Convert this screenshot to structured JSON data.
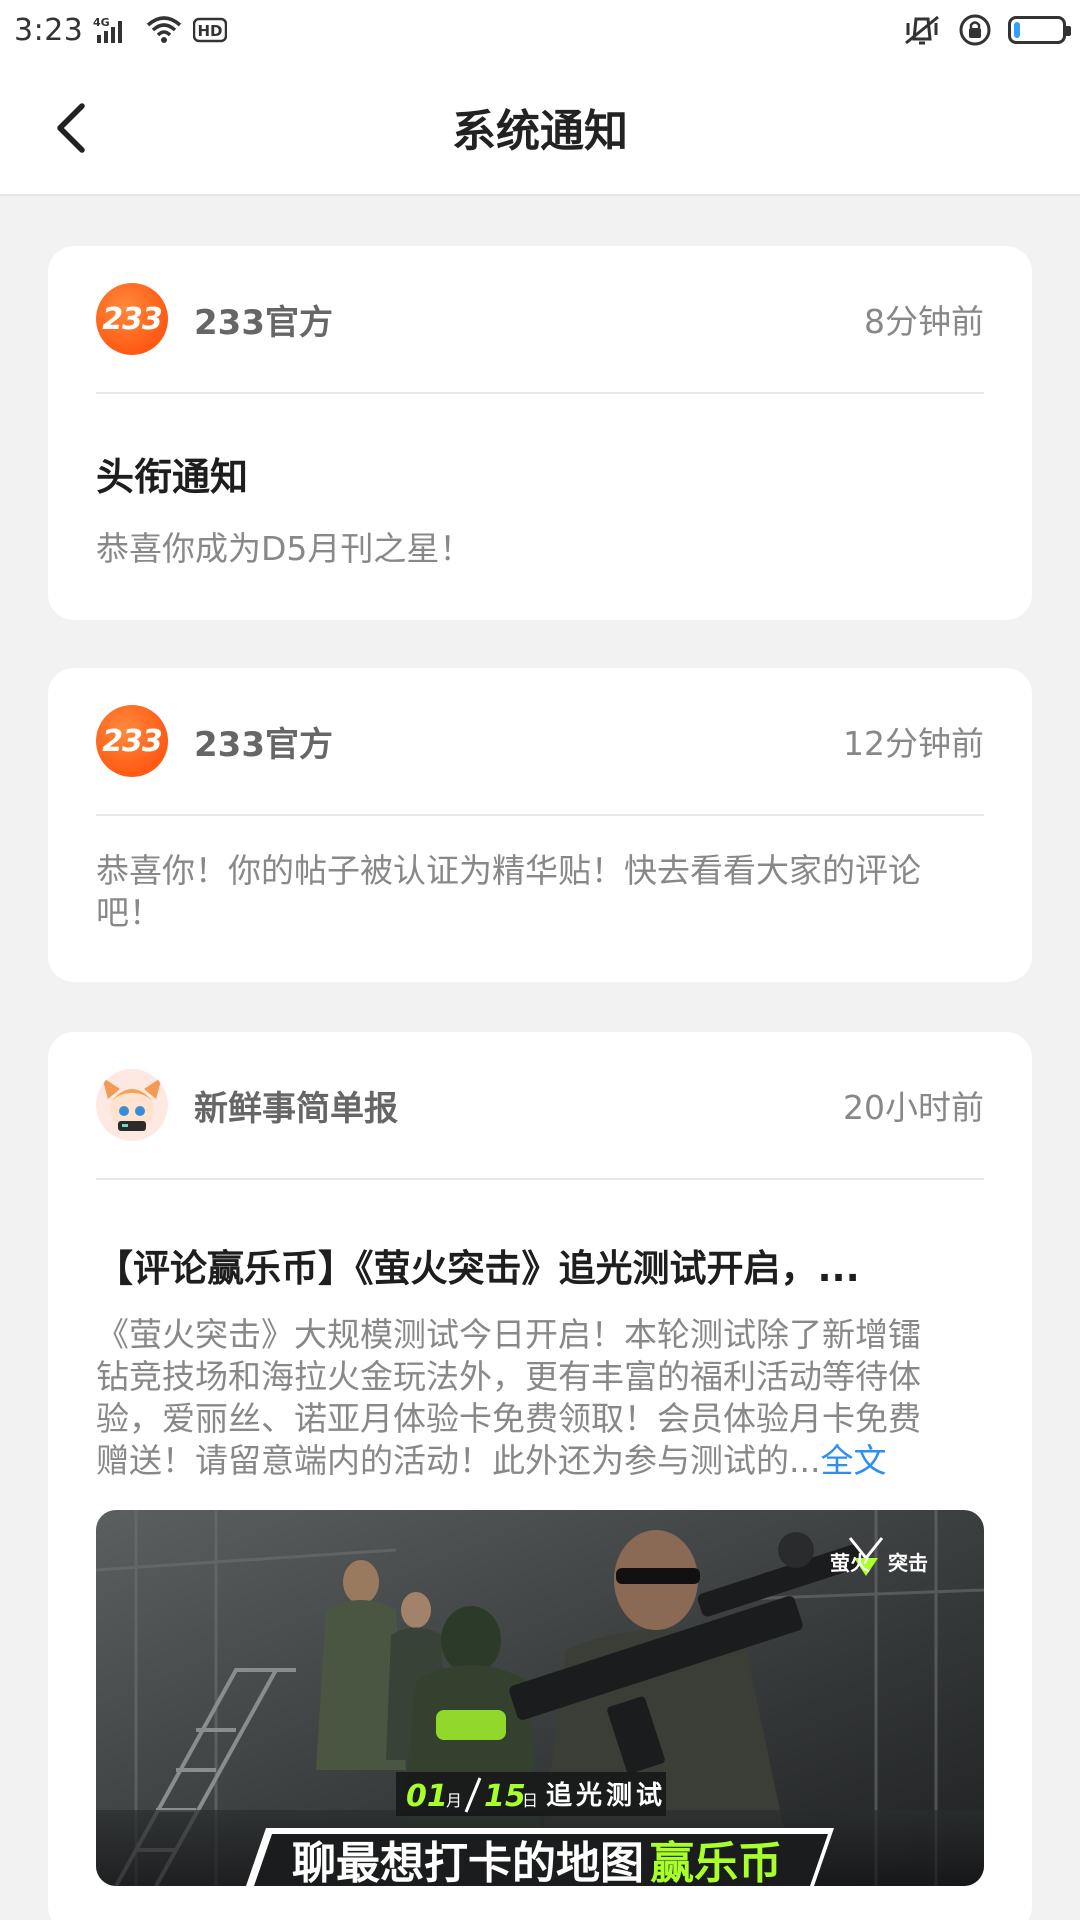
{
  "status_bar": {
    "time": "3:23",
    "network": "4G",
    "hd": "HD",
    "battery_level": 0.12
  },
  "nav": {
    "title": "系统通知"
  },
  "notifications": [
    {
      "sender": "233官方",
      "avatar_text": "233",
      "time": "8分钟前",
      "title": "头衔通知",
      "body": "恭喜你成为D5月刊之星！"
    },
    {
      "sender": "233官方",
      "avatar_text": "233",
      "time": "12分钟前",
      "body_line1": "恭喜你！你的帖子被认证为精华贴！快去看看大家的评论",
      "body_line2": "吧！"
    },
    {
      "sender": "新鲜事简单报",
      "time": "20小时前",
      "title": "【评论赢乐币】《萤火突击》追光测试开启，...",
      "body_lines": [
        "《萤火突击》大规模测试今日开启！本轮测试除了新增镭",
        "钻竞技场和海拉火金玩法外，更有丰富的福利活动等待体",
        "验，爱丽丝、诺亚月体验卡免费领取！会员体验月卡免费",
        "赠送！请留意端内的活动！此外还为参与测试的..."
      ],
      "full_text_link": "全文",
      "banner": {
        "logo_text_left": "萤火",
        "logo_text_right": "突击",
        "date_month": "01",
        "date_month_unit": "月",
        "date_day": "15",
        "date_day_unit": "日",
        "test_label": "追光测试",
        "slogan_main": "聊最想打卡的地图",
        "slogan_highlight": "赢乐币"
      }
    }
  ],
  "colors": {
    "accent_orange": "#ff5a14",
    "link_blue": "#2f8ff0",
    "highlight_green": "#a8ff2a"
  }
}
